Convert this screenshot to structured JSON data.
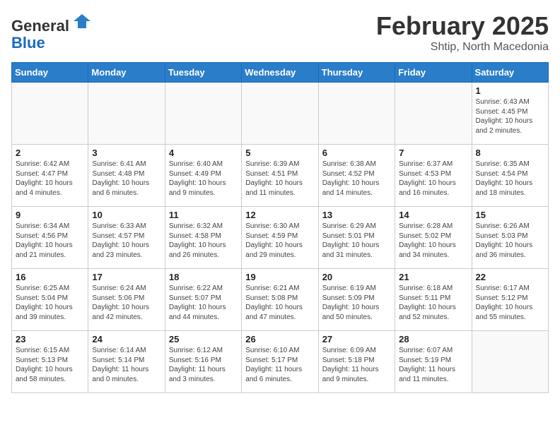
{
  "header": {
    "logo_general": "General",
    "logo_blue": "Blue",
    "month_title": "February 2025",
    "location": "Shtip, North Macedonia"
  },
  "days_of_week": [
    "Sunday",
    "Monday",
    "Tuesday",
    "Wednesday",
    "Thursday",
    "Friday",
    "Saturday"
  ],
  "weeks": [
    [
      {
        "day": "",
        "info": ""
      },
      {
        "day": "",
        "info": ""
      },
      {
        "day": "",
        "info": ""
      },
      {
        "day": "",
        "info": ""
      },
      {
        "day": "",
        "info": ""
      },
      {
        "day": "",
        "info": ""
      },
      {
        "day": "1",
        "info": "Sunrise: 6:43 AM\nSunset: 4:45 PM\nDaylight: 10 hours\nand 2 minutes."
      }
    ],
    [
      {
        "day": "2",
        "info": "Sunrise: 6:42 AM\nSunset: 4:47 PM\nDaylight: 10 hours\nand 4 minutes."
      },
      {
        "day": "3",
        "info": "Sunrise: 6:41 AM\nSunset: 4:48 PM\nDaylight: 10 hours\nand 6 minutes."
      },
      {
        "day": "4",
        "info": "Sunrise: 6:40 AM\nSunset: 4:49 PM\nDaylight: 10 hours\nand 9 minutes."
      },
      {
        "day": "5",
        "info": "Sunrise: 6:39 AM\nSunset: 4:51 PM\nDaylight: 10 hours\nand 11 minutes."
      },
      {
        "day": "6",
        "info": "Sunrise: 6:38 AM\nSunset: 4:52 PM\nDaylight: 10 hours\nand 14 minutes."
      },
      {
        "day": "7",
        "info": "Sunrise: 6:37 AM\nSunset: 4:53 PM\nDaylight: 10 hours\nand 16 minutes."
      },
      {
        "day": "8",
        "info": "Sunrise: 6:35 AM\nSunset: 4:54 PM\nDaylight: 10 hours\nand 18 minutes."
      }
    ],
    [
      {
        "day": "9",
        "info": "Sunrise: 6:34 AM\nSunset: 4:56 PM\nDaylight: 10 hours\nand 21 minutes."
      },
      {
        "day": "10",
        "info": "Sunrise: 6:33 AM\nSunset: 4:57 PM\nDaylight: 10 hours\nand 23 minutes."
      },
      {
        "day": "11",
        "info": "Sunrise: 6:32 AM\nSunset: 4:58 PM\nDaylight: 10 hours\nand 26 minutes."
      },
      {
        "day": "12",
        "info": "Sunrise: 6:30 AM\nSunset: 4:59 PM\nDaylight: 10 hours\nand 29 minutes."
      },
      {
        "day": "13",
        "info": "Sunrise: 6:29 AM\nSunset: 5:01 PM\nDaylight: 10 hours\nand 31 minutes."
      },
      {
        "day": "14",
        "info": "Sunrise: 6:28 AM\nSunset: 5:02 PM\nDaylight: 10 hours\nand 34 minutes."
      },
      {
        "day": "15",
        "info": "Sunrise: 6:26 AM\nSunset: 5:03 PM\nDaylight: 10 hours\nand 36 minutes."
      }
    ],
    [
      {
        "day": "16",
        "info": "Sunrise: 6:25 AM\nSunset: 5:04 PM\nDaylight: 10 hours\nand 39 minutes."
      },
      {
        "day": "17",
        "info": "Sunrise: 6:24 AM\nSunset: 5:06 PM\nDaylight: 10 hours\nand 42 minutes."
      },
      {
        "day": "18",
        "info": "Sunrise: 6:22 AM\nSunset: 5:07 PM\nDaylight: 10 hours\nand 44 minutes."
      },
      {
        "day": "19",
        "info": "Sunrise: 6:21 AM\nSunset: 5:08 PM\nDaylight: 10 hours\nand 47 minutes."
      },
      {
        "day": "20",
        "info": "Sunrise: 6:19 AM\nSunset: 5:09 PM\nDaylight: 10 hours\nand 50 minutes."
      },
      {
        "day": "21",
        "info": "Sunrise: 6:18 AM\nSunset: 5:11 PM\nDaylight: 10 hours\nand 52 minutes."
      },
      {
        "day": "22",
        "info": "Sunrise: 6:17 AM\nSunset: 5:12 PM\nDaylight: 10 hours\nand 55 minutes."
      }
    ],
    [
      {
        "day": "23",
        "info": "Sunrise: 6:15 AM\nSunset: 5:13 PM\nDaylight: 10 hours\nand 58 minutes."
      },
      {
        "day": "24",
        "info": "Sunrise: 6:14 AM\nSunset: 5:14 PM\nDaylight: 11 hours\nand 0 minutes."
      },
      {
        "day": "25",
        "info": "Sunrise: 6:12 AM\nSunset: 5:16 PM\nDaylight: 11 hours\nand 3 minutes."
      },
      {
        "day": "26",
        "info": "Sunrise: 6:10 AM\nSunset: 5:17 PM\nDaylight: 11 hours\nand 6 minutes."
      },
      {
        "day": "27",
        "info": "Sunrise: 6:09 AM\nSunset: 5:18 PM\nDaylight: 11 hours\nand 9 minutes."
      },
      {
        "day": "28",
        "info": "Sunrise: 6:07 AM\nSunset: 5:19 PM\nDaylight: 11 hours\nand 11 minutes."
      },
      {
        "day": "",
        "info": ""
      }
    ]
  ]
}
